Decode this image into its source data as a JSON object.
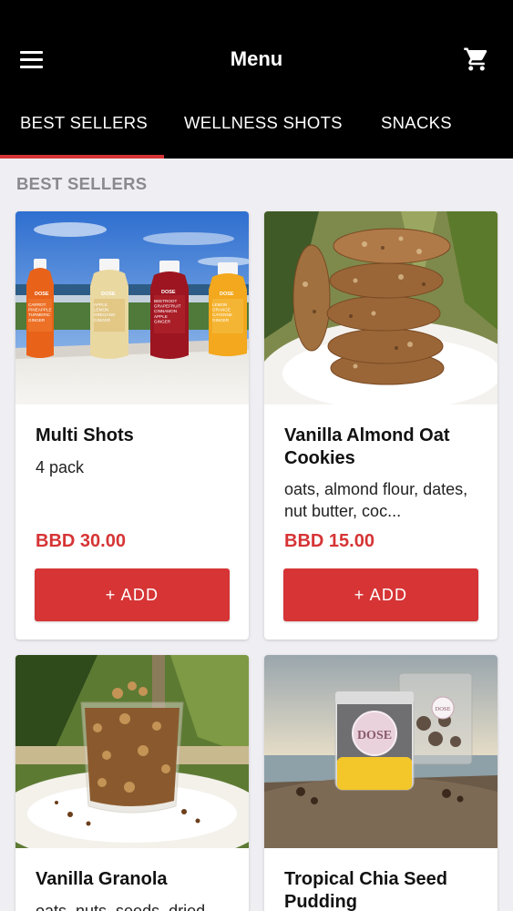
{
  "header": {
    "title": "Menu",
    "menu_icon": "hamburger-menu-icon",
    "cart_icon": "shopping-cart-icon"
  },
  "tabs": [
    {
      "label": "BEST SELLERS",
      "active": true
    },
    {
      "label": "WELLNESS SHOTS",
      "active": false
    },
    {
      "label": "SNACKS",
      "active": false
    }
  ],
  "section": {
    "title": "BEST SELLERS"
  },
  "products": [
    {
      "name": "Multi Shots",
      "description": "4 pack",
      "price": "BBD 30.00",
      "button": "+ ADD",
      "image_text": {
        "brand": "DOSE",
        "bottles": [
          "CARROT PINEAPPLE TURMERIC GINGER",
          "APPLE LEMON OREGANO GINGER",
          "BEETROOT GRAPEFRUIT CINNAMON APPLE GINGER",
          "LEMON ORANGE CAYENNE GINGER"
        ]
      }
    },
    {
      "name": "Vanilla Almond Oat Cookies",
      "description": "oats, almond flour, dates, nut butter, coc...",
      "price": "BBD 15.00",
      "button": "+ ADD"
    },
    {
      "name": "Vanilla Granola",
      "description": "oats, nuts, seeds, dried"
    },
    {
      "name": "Tropical Chia Seed Pudding",
      "image_text": {
        "jar_label": "DOSE",
        "bag_label": "DOSE"
      }
    }
  ],
  "colors": {
    "header_bg": "#000000",
    "accent": "#d63435",
    "page_bg": "#efeef2",
    "heading_gray": "#8a8a8e"
  }
}
